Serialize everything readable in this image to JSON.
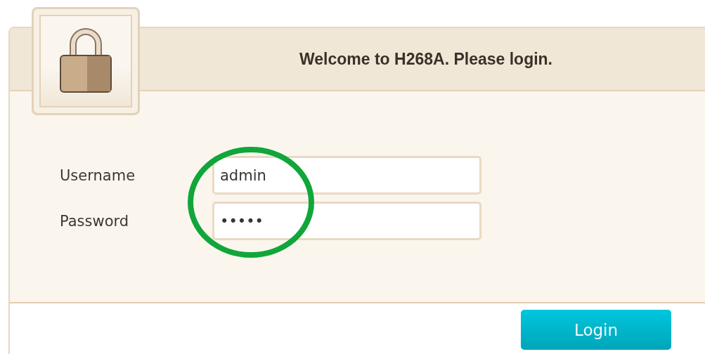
{
  "header": {
    "title": "Welcome to H268A. Please login."
  },
  "fields": [
    {
      "label": "Username",
      "value": "admin"
    },
    {
      "label": "Password",
      "value": "•••••"
    }
  ],
  "buttons": [
    "Login"
  ]
}
